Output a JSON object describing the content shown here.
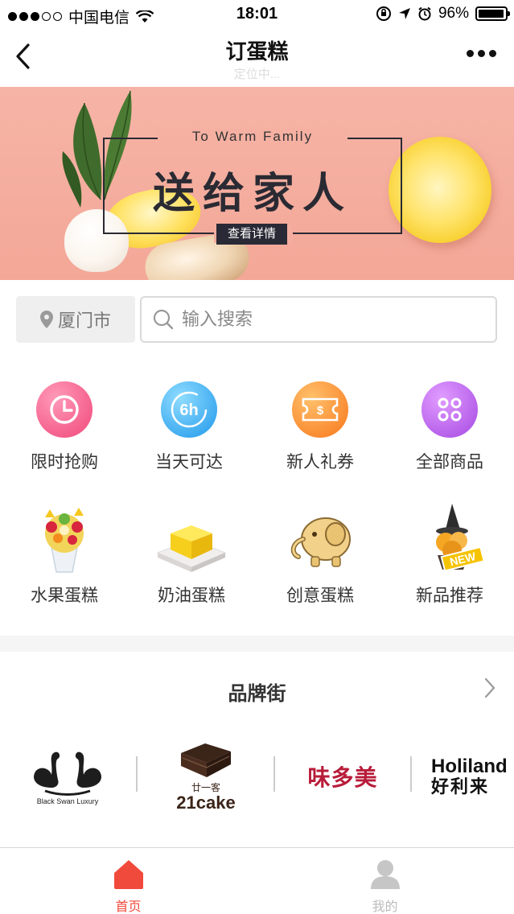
{
  "status_bar": {
    "carrier": "中国电信",
    "time": "18:01",
    "battery": "96%",
    "battery_level": 0.96
  },
  "nav": {
    "title": "订蛋糕",
    "subtitle": "定位中...",
    "back_icon": "chevron-left-icon",
    "more_icon": "more-dots-icon"
  },
  "banner": {
    "subtitle": "To Warm Family",
    "title": "送给家人",
    "button": "查看详情"
  },
  "search": {
    "city": "厦门市",
    "placeholder": "输入搜索",
    "value": ""
  },
  "categories": [
    {
      "label": "限时抢购",
      "icon": "clock-icon",
      "color": "#f25a8a"
    },
    {
      "label": "当天可达",
      "icon": "6h-icon",
      "color": "#34a8f0",
      "icon_text": "6h"
    },
    {
      "label": "新人礼券",
      "icon": "coupon-icon",
      "color": "#fb8a2d"
    },
    {
      "label": "全部商品",
      "icon": "grid-dots-icon",
      "color": "#b85ce8"
    },
    {
      "label": "水果蛋糕",
      "icon": "fruit-cake-icon"
    },
    {
      "label": "奶油蛋糕",
      "icon": "cream-cake-icon"
    },
    {
      "label": "创意蛋糕",
      "icon": "elephant-cake-icon"
    },
    {
      "label": "新品推荐",
      "icon": "new-cake-icon",
      "badge": "NEW"
    }
  ],
  "brands": {
    "title": "品牌街",
    "items": [
      {
        "logo": "black-swan-logo",
        "caption": "Black Swan Luxury"
      },
      {
        "logo": "21cake-logo",
        "caption_top": "廿一客",
        "caption": "21cake"
      },
      {
        "logo": "weiduomei-logo",
        "caption": "味多美"
      },
      {
        "logo": "holiland-logo",
        "caption_top": "Holiland",
        "caption": "好利来"
      }
    ]
  },
  "tab_bar": {
    "tabs": [
      {
        "label": "首页",
        "icon": "home-icon",
        "active": true
      },
      {
        "label": "我的",
        "icon": "user-icon",
        "active": false
      }
    ],
    "active_color": "#f04a3c",
    "inactive_color": "#bbbbbb"
  }
}
